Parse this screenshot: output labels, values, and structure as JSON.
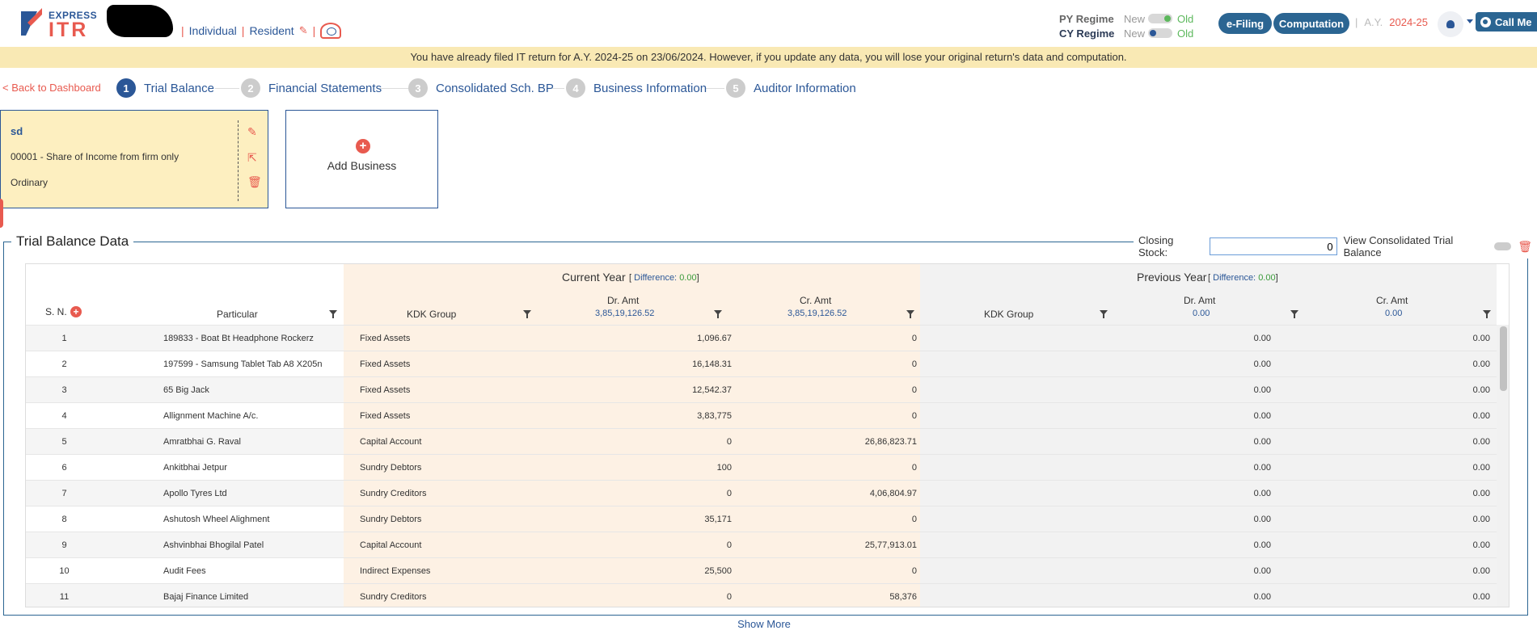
{
  "header": {
    "logo_express": "EXPRESS",
    "logo_itr": "ITR",
    "individual": "Individual",
    "resident": "Resident",
    "separator": "|",
    "py_regime_label": "PY Regime",
    "cy_regime_label": "CY Regime",
    "new_label": "New",
    "old_label": "Old",
    "efiling_label": "e-Filing",
    "computation_label": "Computation",
    "ay_label": "A.Y.",
    "ay_value": "2024-25",
    "callme_label": "Call Me"
  },
  "notice": "You have already filed IT return for A.Y. 2024-25 on 23/06/2024. However, if you update any data, you will lose your original return's data and computation.",
  "stepper": {
    "back_label": "< Back to Dashboard",
    "steps": [
      {
        "num": "1",
        "label": "Trial Balance"
      },
      {
        "num": "2",
        "label": "Financial Statements"
      },
      {
        "num": "3",
        "label": "Consolidated Sch. BP"
      },
      {
        "num": "4",
        "label": "Business Information"
      },
      {
        "num": "5",
        "label": "Auditor Information"
      }
    ]
  },
  "business_card": {
    "name": "sd",
    "code": "00001 - Share of Income from firm only",
    "type": "Ordinary"
  },
  "add_business_label": "Add Business",
  "trial_balance": {
    "title": "Trial Balance Data",
    "closing_stock_label": "Closing Stock:",
    "closing_stock_value": "0",
    "view_consolidated_label": "View Consolidated Trial Balance",
    "headers": {
      "sn": "S. N.",
      "particular": "Particular",
      "current_year": "Current Year",
      "previous_year": "Previous Year",
      "difference_label": "Difference:",
      "cy_difference": "0.00",
      "py_difference": "0.00",
      "kdk_group": "KDK Group",
      "dr_amt": "Dr. Amt",
      "cr_amt": "Cr. Amt",
      "cy_dr_total": "3,85,19,126.52",
      "cy_cr_total": "3,85,19,126.52",
      "py_dr_total": "0.00",
      "py_cr_total": "0.00"
    },
    "rows": [
      {
        "sn": "1",
        "particular": "189833 - Boat Bt Headphone Rockerz",
        "kdk": "Fixed Assets",
        "dr": "1,096.67",
        "cr": "0",
        "py_dr": "0.00",
        "py_cr": "0.00"
      },
      {
        "sn": "2",
        "particular": "197599 - Samsung Tablet Tab A8 X205n",
        "kdk": "Fixed Assets",
        "dr": "16,148.31",
        "cr": "0",
        "py_dr": "0.00",
        "py_cr": "0.00"
      },
      {
        "sn": "3",
        "particular": "65 Big Jack",
        "kdk": "Fixed Assets",
        "dr": "12,542.37",
        "cr": "0",
        "py_dr": "0.00",
        "py_cr": "0.00"
      },
      {
        "sn": "4",
        "particular": "Allignment Machine A/c.",
        "kdk": "Fixed Assets",
        "dr": "3,83,775",
        "cr": "0",
        "py_dr": "0.00",
        "py_cr": "0.00"
      },
      {
        "sn": "5",
        "particular": "Amratbhai G. Raval",
        "kdk": "Capital Account",
        "dr": "0",
        "cr": "26,86,823.71",
        "py_dr": "0.00",
        "py_cr": "0.00"
      },
      {
        "sn": "6",
        "particular": "Ankitbhai Jetpur",
        "kdk": "Sundry Debtors",
        "dr": "100",
        "cr": "0",
        "py_dr": "0.00",
        "py_cr": "0.00"
      },
      {
        "sn": "7",
        "particular": "Apollo Tyres Ltd",
        "kdk": "Sundry Creditors",
        "dr": "0",
        "cr": "4,06,804.97",
        "py_dr": "0.00",
        "py_cr": "0.00"
      },
      {
        "sn": "8",
        "particular": "Ashutosh Wheel Alighment",
        "kdk": "Sundry Debtors",
        "dr": "35,171",
        "cr": "0",
        "py_dr": "0.00",
        "py_cr": "0.00"
      },
      {
        "sn": "9",
        "particular": "Ashvinbhai Bhogilal Patel",
        "kdk": "Capital Account",
        "dr": "0",
        "cr": "25,77,913.01",
        "py_dr": "0.00",
        "py_cr": "0.00"
      },
      {
        "sn": "10",
        "particular": "Audit Fees",
        "kdk": "Indirect Expenses",
        "dr": "25,500",
        "cr": "0",
        "py_dr": "0.00",
        "py_cr": "0.00"
      },
      {
        "sn": "11",
        "particular": "Bajaj Finance Limited",
        "kdk": "Sundry Creditors",
        "dr": "0",
        "cr": "58,376",
        "py_dr": "0.00",
        "py_cr": "0.00"
      }
    ]
  },
  "show_more_label": "Show More",
  "colors": {
    "brand_blue": "#2b5797",
    "accent_red": "#e85a4f",
    "notice_bg": "#f9e9b4",
    "card_bg": "#fdefc0",
    "cy_band": "#fdf1e4",
    "py_band": "#f2f2f2"
  }
}
